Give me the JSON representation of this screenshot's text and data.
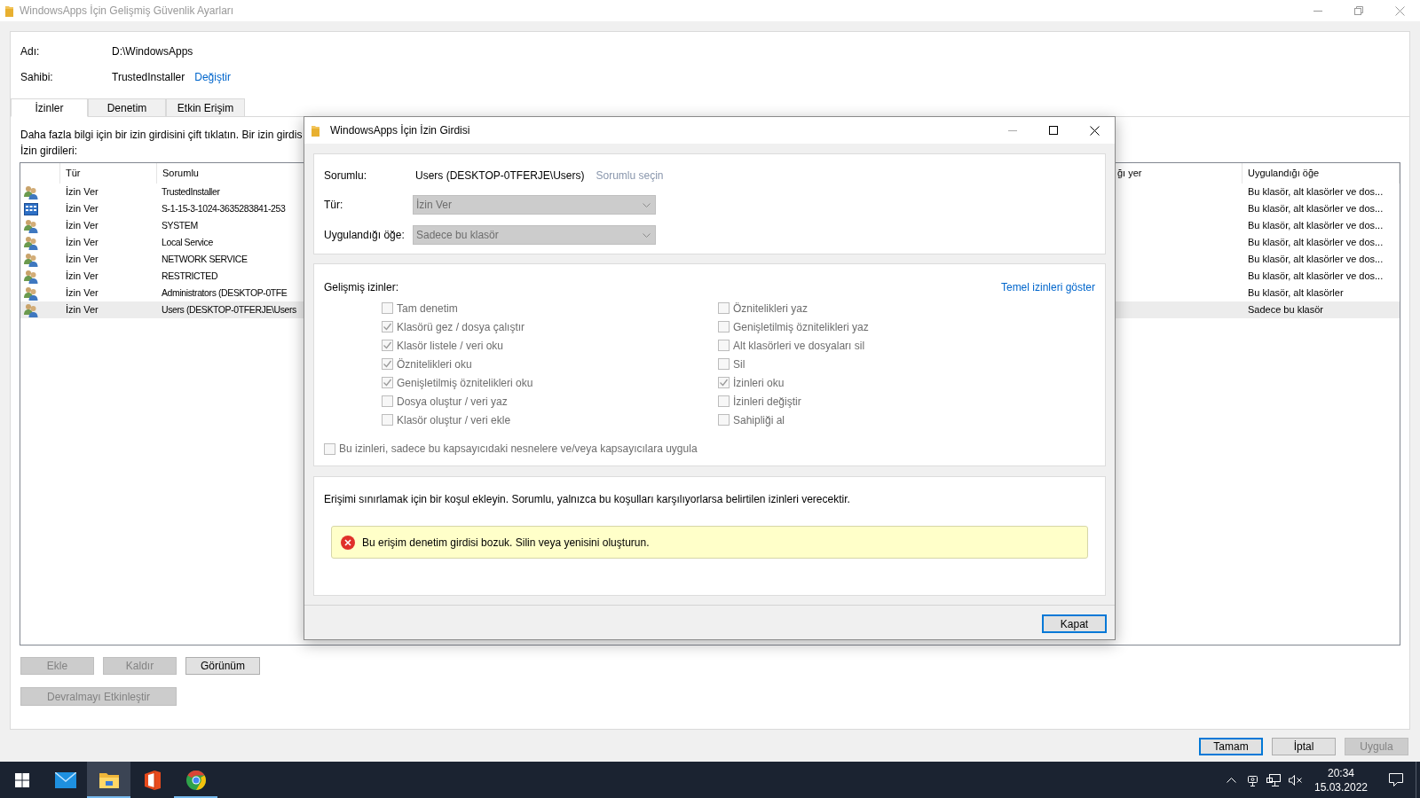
{
  "window": {
    "title": "WindowsApps İçin Gelişmiş Güvenlik Ayarları"
  },
  "object": {
    "name_label": "Adı:",
    "name": "D:\\WindowsApps",
    "owner_label": "Sahibi:",
    "owner": "TrustedInstaller",
    "change_link": "Değiştir"
  },
  "tabs": [
    {
      "label": "İzinler",
      "selected": true
    },
    {
      "label": "Denetim",
      "selected": false
    },
    {
      "label": "Etkin Erişim",
      "selected": false
    }
  ],
  "hint": "Daha fazla bilgi için bir izin girdisini çift tıklatın. Bir izin girdis",
  "entries_label": "İzin girdileri:",
  "table": {
    "columns": [
      "Tür",
      "Sorumlu",
      "ğı yer",
      "Uygulandığı öğe"
    ],
    "rows": [
      {
        "kind": "group",
        "type": "İzin Ver",
        "principal": "TrustedInstaller",
        "applies_to": "Bu klasör, alt klasörler ve dos...",
        "selected": false
      },
      {
        "kind": "package",
        "type": "İzin Ver",
        "principal": "S-1-15-3-1024-3635283841-253",
        "applies_to": "Bu klasör, alt klasörler ve dos...",
        "selected": false
      },
      {
        "kind": "group",
        "type": "İzin Ver",
        "principal": "SYSTEM",
        "applies_to": "Bu klasör, alt klasörler ve dos...",
        "selected": false
      },
      {
        "kind": "group",
        "type": "İzin Ver",
        "principal": "Local Service",
        "applies_to": "Bu klasör, alt klasörler ve dos...",
        "selected": false
      },
      {
        "kind": "group",
        "type": "İzin Ver",
        "principal": "NETWORK SERVICE",
        "applies_to": "Bu klasör, alt klasörler ve dos...",
        "selected": false
      },
      {
        "kind": "group",
        "type": "İzin Ver",
        "principal": "RESTRICTED",
        "applies_to": "Bu klasör, alt klasörler ve dos...",
        "selected": false
      },
      {
        "kind": "group",
        "type": "İzin Ver",
        "principal": "Administrators (DESKTOP-0TFE",
        "applies_to": "Bu klasör, alt klasörler",
        "selected": false
      },
      {
        "kind": "group",
        "type": "İzin Ver",
        "principal": "Users (DESKTOP-0TFERJE\\Users",
        "applies_to": "Sadece bu klasör",
        "selected": true
      }
    ]
  },
  "buttons": [
    {
      "label": "Ekle",
      "disabled": true
    },
    {
      "label": "Kaldır",
      "disabled": true
    },
    {
      "label": "Görünüm",
      "disabled": false
    }
  ],
  "inherit_button": {
    "label": "Devralmayı Etkinleştir",
    "disabled": true
  },
  "footer_buttons": [
    {
      "label": "Tamam",
      "disabled": false,
      "default": true
    },
    {
      "label": "İptal",
      "disabled": false,
      "default": false
    },
    {
      "label": "Uygula",
      "disabled": true,
      "default": false
    }
  ],
  "dialog": {
    "title": "WindowsApps İçin İzin Girdisi",
    "principal_label": "Sorumlu:",
    "principal": "Users (DESKTOP-0TFERJE\\Users)",
    "select_link": {
      "label": "Sorumlu seçin",
      "disabled": true
    },
    "type": {
      "label": "Tür:",
      "value": "İzin Ver",
      "disabled": true
    },
    "applies_to": {
      "label": "Uygulandığı öğe:",
      "value": "Sadece bu klasör",
      "disabled": true
    },
    "advanced_label": "Gelişmiş izinler:",
    "basic_link": "Temel izinleri göster",
    "permissions_left": [
      {
        "label": "Tam denetim",
        "checked": false,
        "disabled": true
      },
      {
        "label": "Klasörü gez / dosya çalıştır",
        "checked": true,
        "disabled": true
      },
      {
        "label": "Klasör listele / veri oku",
        "checked": true,
        "disabled": true
      },
      {
        "label": "Öznitelikleri oku",
        "checked": true,
        "disabled": true
      },
      {
        "label": "Genişletilmiş öznitelikleri oku",
        "checked": true,
        "disabled": true
      },
      {
        "label": "Dosya oluştur / veri yaz",
        "checked": false,
        "disabled": true
      },
      {
        "label": "Klasör oluştur / veri ekle",
        "checked": false,
        "disabled": true
      }
    ],
    "permissions_right": [
      {
        "label": "Öznitelikleri yaz",
        "checked": false,
        "disabled": true
      },
      {
        "label": "Genişletilmiş öznitelikleri yaz",
        "checked": false,
        "disabled": true
      },
      {
        "label": "Alt klasörleri ve dosyaları sil",
        "checked": false,
        "disabled": true
      },
      {
        "label": "Sil",
        "checked": false,
        "disabled": true
      },
      {
        "label": "İzinleri oku",
        "checked": true,
        "disabled": true
      },
      {
        "label": "İzinleri değiştir",
        "checked": false,
        "disabled": true
      },
      {
        "label": "Sahipliği al",
        "checked": false,
        "disabled": true
      }
    ],
    "container_only": {
      "label": "Bu izinleri, sadece bu kapsayıcıdaki nesnelere ve/veya kapsayıcılara uygula",
      "checked": false,
      "disabled": true
    },
    "condition_text": "Erişimi sınırlamak için bir koşul ekleyin. Sorumlu, yalnızca bu koşulları karşılıyorlarsa belirtilen izinleri verecektir.",
    "error": "Bu erişim denetim girdisi bozuk. Silin veya yenisini oluşturun.",
    "close_button": "Kapat"
  },
  "taskbar": {
    "apps": [
      {
        "kind": "mail",
        "open": false,
        "active": false
      },
      {
        "kind": "explorer",
        "open": true,
        "active": true
      },
      {
        "kind": "office",
        "open": false,
        "active": false
      },
      {
        "kind": "browser",
        "open": true,
        "active": false
      }
    ],
    "time": "20:34",
    "date": "15.03.2022"
  }
}
